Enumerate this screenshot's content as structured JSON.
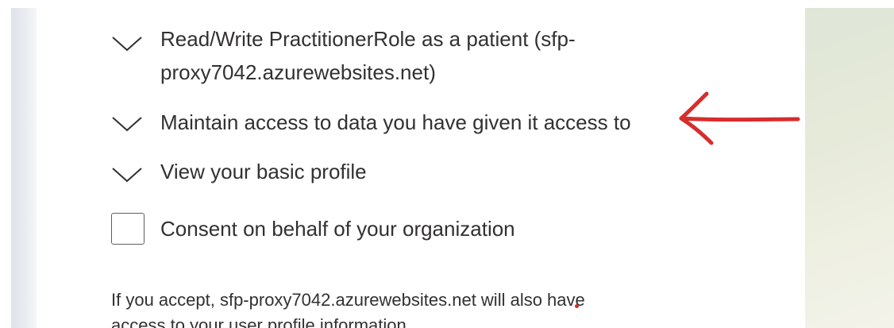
{
  "permissions": [
    {
      "line1": "Read/Write PractitionerRole as a patient (sfp-",
      "line2": "proxy7042.azurewebsites.net)",
      "icon": "chevron-down-icon"
    },
    {
      "line1": "Maintain access to data you have given it access to",
      "icon": "chevron-down-icon"
    },
    {
      "line1": "View your basic profile",
      "icon": "chevron-down-icon"
    }
  ],
  "consent": {
    "label": "Consent on behalf of your organization",
    "checked": false
  },
  "footnote": {
    "line1": "If you accept, sfp-proxy7042.azurewebsites.net will also have",
    "line2": "access to your user profile information."
  },
  "annotation": {
    "arrow_color": "#d62d2d"
  },
  "colors": {
    "text": "#323130",
    "left_strip": "#e6e8ee",
    "right_panel": "#e6ead9"
  }
}
